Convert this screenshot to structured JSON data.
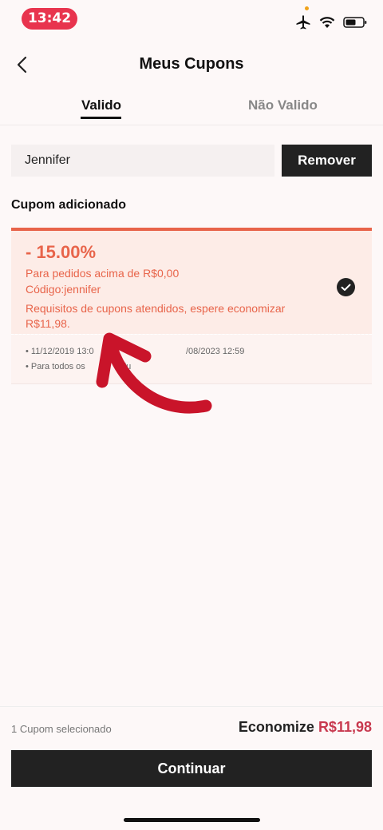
{
  "status_bar": {
    "time": "13:42"
  },
  "header": {
    "title": "Meus Cupons"
  },
  "tabs": [
    {
      "label": "Valido"
    },
    {
      "label": "Não Valido"
    }
  ],
  "coupon_form": {
    "input_value": "Jennifer",
    "remove_label": "Remover"
  },
  "section_label": "Cupom adicionado",
  "coupon": {
    "discount": "- 15.00%",
    "min_order": "Para pedidos acima de R$0,00",
    "code": "Código:jennifer",
    "requirement_line1": "Requisitos de cupons atendidos, espere economizar",
    "requirement_line2": "R$11,98.",
    "validity": "• 11/12/2019 13:0",
    "validity_end": "/08/2023 12:59",
    "scope": "• Para todos os",
    "scope_end": "du"
  },
  "footer": {
    "selected_count": "1 Cupom selecionado",
    "savings_label": "Economize",
    "savings_amount": "R$11,98",
    "continue_label": "Continuar"
  },
  "colors": {
    "accent": "#e8644a",
    "brand_red": "#c8394f",
    "annotation_arrow": "#c9142a"
  }
}
